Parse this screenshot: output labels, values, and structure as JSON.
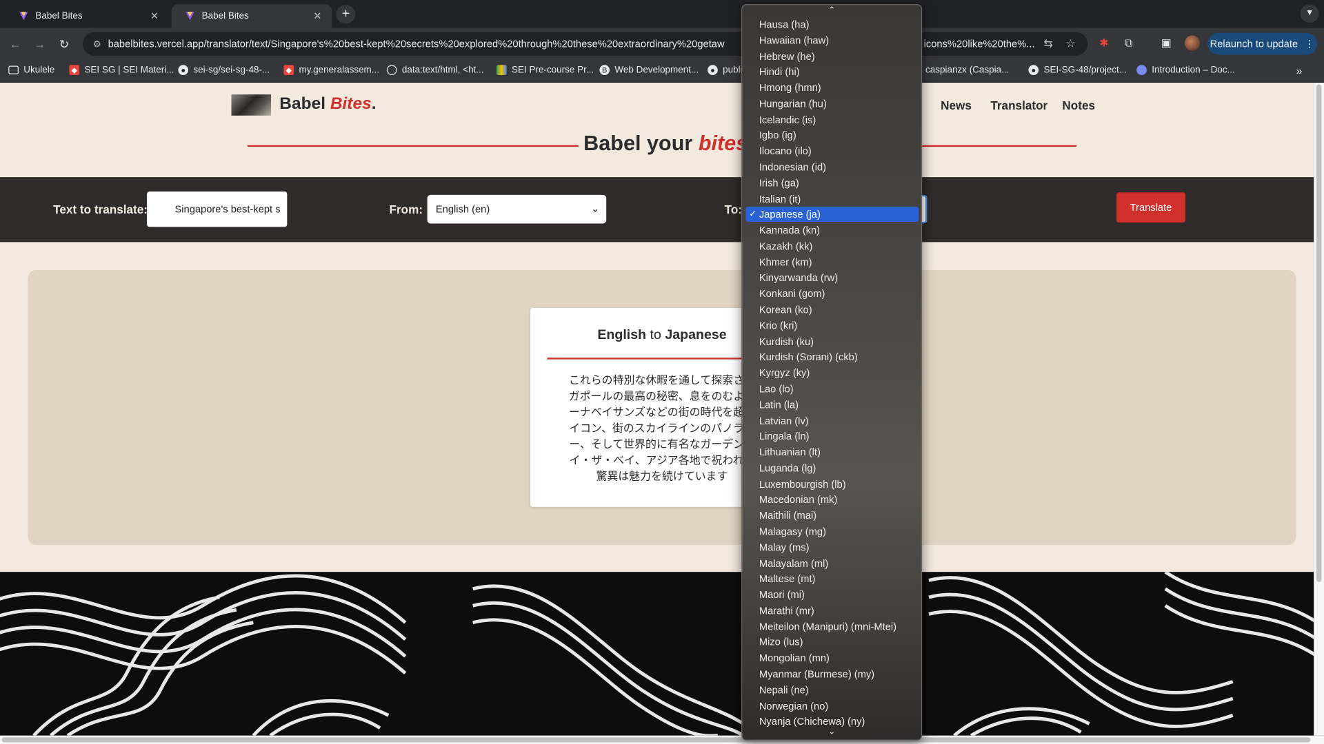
{
  "browser": {
    "tabs": [
      {
        "title": "Babel Bites",
        "close": "✕"
      },
      {
        "title": "Babel Bites",
        "close": "✕"
      }
    ],
    "new_tab": "+",
    "url": "babelbites.vercel.app/translator/text/Singapore's%20best-kept%20secrets%20explored%20through%20these%20extraordinary%20getaw",
    "url_tail": "icons%20like%20the%...",
    "relaunch_label": "Relaunch to update",
    "relaunch_more": "⋮",
    "bookmarks": [
      {
        "label": "Ukulele",
        "icon": "folder-icon"
      },
      {
        "label": "SEI SG | SEI Materi...",
        "icon": "ga-icon"
      },
      {
        "label": "sei-sg/sei-sg-48-...",
        "icon": "github-icon"
      },
      {
        "label": "my.generalassem...",
        "icon": "ga-icon"
      },
      {
        "label": "data:text/html, <ht...",
        "icon": "globe-icon"
      },
      {
        "label": "SEI Pre-course Pr...",
        "icon": "drive-icon"
      },
      {
        "label": "Web Development...",
        "icon": "bookmark-icon"
      },
      {
        "label": "publi",
        "icon": "github-icon"
      },
      {
        "label": "caspianzx (Caspia...",
        "icon": "github-icon"
      },
      {
        "label": "SEI-SG-48/project...",
        "icon": "github-icon"
      },
      {
        "label": "Introduction – Doc...",
        "icon": "docs-icon"
      }
    ],
    "bookmarks_more": "»"
  },
  "site": {
    "logo_main": "Babel ",
    "logo_accent": "Bites",
    "logo_dot": ".",
    "nav": [
      "News",
      "Translator",
      "Notes"
    ],
    "heading_main": "Babel your ",
    "heading_accent": "bites",
    "heading_colon": ":",
    "form": {
      "text_label": "Text to translate:",
      "text_value": "Singapore's best-kept s",
      "from_label": "From:",
      "from_value": "English (en)",
      "to_label": "To:",
      "translate_button": "Translate"
    },
    "result": {
      "from_lang": "English",
      "connector": " to ",
      "to_lang": "Japanese",
      "lines": [
        "これらの特別な休暇を通して探索され",
        "ガポールの最高の秘密、息をのむよう",
        "ーナベイサンズなどの街の時代を超越",
        "イコン、街のスカイラインのパノラマ",
        "ー、そして世界的に有名なガーデンズ",
        "イ・ザ・ベイ、アジア各地で祝われる",
        "驚異は魅力を続けています"
      ]
    }
  },
  "dropdown": {
    "scroll_up": "⌃",
    "scroll_down": "⌄",
    "check": "✓",
    "selected_index": 12,
    "options": [
      "Hausa (ha)",
      "Hawaiian (haw)",
      "Hebrew (he)",
      "Hindi (hi)",
      "Hmong (hmn)",
      "Hungarian (hu)",
      "Icelandic (is)",
      "Igbo (ig)",
      "Ilocano (ilo)",
      "Indonesian (id)",
      "Irish (ga)",
      "Italian (it)",
      "Japanese (ja)",
      "Kannada (kn)",
      "Kazakh (kk)",
      "Khmer (km)",
      "Kinyarwanda (rw)",
      "Konkani (gom)",
      "Korean (ko)",
      "Krio (kri)",
      "Kurdish (ku)",
      "Kurdish (Sorani) (ckb)",
      "Kyrgyz (ky)",
      "Lao (lo)",
      "Latin (la)",
      "Latvian (lv)",
      "Lingala (ln)",
      "Lithuanian (lt)",
      "Luganda (lg)",
      "Luxembourgish (lb)",
      "Macedonian (mk)",
      "Maithili (mai)",
      "Malagasy (mg)",
      "Malay (ms)",
      "Malayalam (ml)",
      "Maltese (mt)",
      "Maori (mi)",
      "Marathi (mr)",
      "Meiteilon (Manipuri) (mni-Mtei)",
      "Mizo (lus)",
      "Mongolian (mn)",
      "Myanmar (Burmese) (my)",
      "Nepali (ne)",
      "Norwegian (no)",
      "Nyanja (Chichewa) (ny)"
    ]
  },
  "colors": {
    "accent": "#d0312d",
    "page_bg": "#f3e9df",
    "form_bar": "#2e2b2a",
    "panel": "#e2d4c2",
    "selection": "#2a62d6"
  }
}
